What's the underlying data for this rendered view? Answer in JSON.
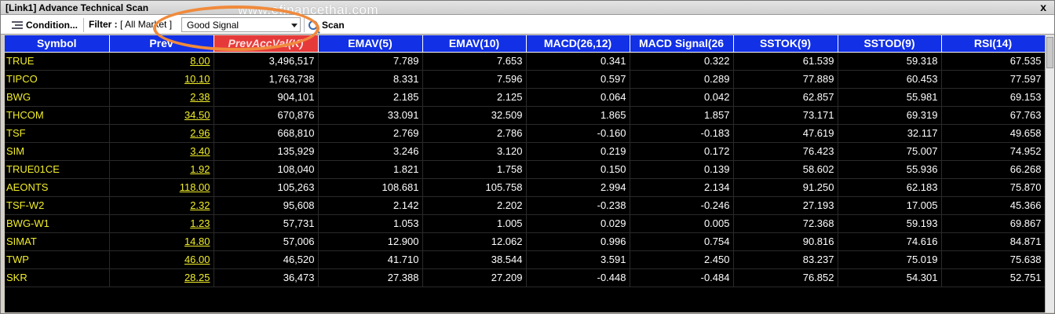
{
  "window": {
    "title": "[Link1] Advance Technical Scan",
    "close_glyph": "x"
  },
  "watermark": "www.efinancethai.com",
  "toolbar": {
    "condition_label": "Condition...",
    "filter_label": "Filter :",
    "filter_value": "[ All Market ]",
    "signal_value": "Good Signal",
    "scan_label": "Scan"
  },
  "table": {
    "columns": [
      "Symbol",
      "Prev",
      "PrevAccVal(K)",
      "EMAV(5)",
      "EMAV(10)",
      "MACD(26,12)",
      "MACD Signal(26",
      "SSTOK(9)",
      "SSTOD(9)",
      "RSI(14)"
    ],
    "rows": [
      [
        "TRUE",
        "8.00",
        "3,496,517",
        "7.789",
        "7.653",
        "0.341",
        "0.322",
        "61.539",
        "59.318",
        "67.535"
      ],
      [
        "TIPCO",
        "10.10",
        "1,763,738",
        "8.331",
        "7.596",
        "0.597",
        "0.289",
        "77.889",
        "60.453",
        "77.597"
      ],
      [
        "BWG",
        "2.38",
        "904,101",
        "2.185",
        "2.125",
        "0.064",
        "0.042",
        "62.857",
        "55.981",
        "69.153"
      ],
      [
        "THCOM",
        "34.50",
        "670,876",
        "33.091",
        "32.509",
        "1.865",
        "1.857",
        "73.171",
        "69.319",
        "67.763"
      ],
      [
        "TSF",
        "2.96",
        "668,810",
        "2.769",
        "2.786",
        "-0.160",
        "-0.183",
        "47.619",
        "32.117",
        "49.658"
      ],
      [
        "SIM",
        "3.40",
        "135,929",
        "3.246",
        "3.120",
        "0.219",
        "0.172",
        "76.423",
        "75.007",
        "74.952"
      ],
      [
        "TRUE01CE",
        "1.92",
        "108,040",
        "1.821",
        "1.758",
        "0.150",
        "0.139",
        "58.602",
        "55.936",
        "66.268"
      ],
      [
        "AEONTS",
        "118.00",
        "105,263",
        "108.681",
        "105.758",
        "2.994",
        "2.134",
        "91.250",
        "62.183",
        "75.870"
      ],
      [
        "TSF-W2",
        "2.32",
        "95,608",
        "2.142",
        "2.202",
        "-0.238",
        "-0.246",
        "27.193",
        "17.005",
        "45.366"
      ],
      [
        "BWG-W1",
        "1.23",
        "57,731",
        "1.053",
        "1.005",
        "0.029",
        "0.005",
        "72.368",
        "59.193",
        "69.867"
      ],
      [
        "SIMAT",
        "14.80",
        "57,006",
        "12.900",
        "12.062",
        "0.996",
        "0.754",
        "90.816",
        "74.616",
        "84.871"
      ],
      [
        "TWP",
        "46.00",
        "46,520",
        "41.710",
        "38.544",
        "3.591",
        "2.450",
        "83.237",
        "75.019",
        "75.638"
      ],
      [
        "SKR",
        "28.25",
        "36,473",
        "27.388",
        "27.209",
        "-0.448",
        "-0.484",
        "76.852",
        "54.301",
        "52.751"
      ]
    ]
  },
  "colors": {
    "header_bg": "#1230e6",
    "sorted_header_bg": "#e63a3a",
    "grid_bg": "#000000",
    "symbol_text": "#f2ee2a",
    "highlight_oval": "#f08a3c"
  },
  "icons": {
    "condition": "filter-list-icon",
    "scan": "magnifier-icon",
    "dropdown": "chevron-down-icon"
  }
}
